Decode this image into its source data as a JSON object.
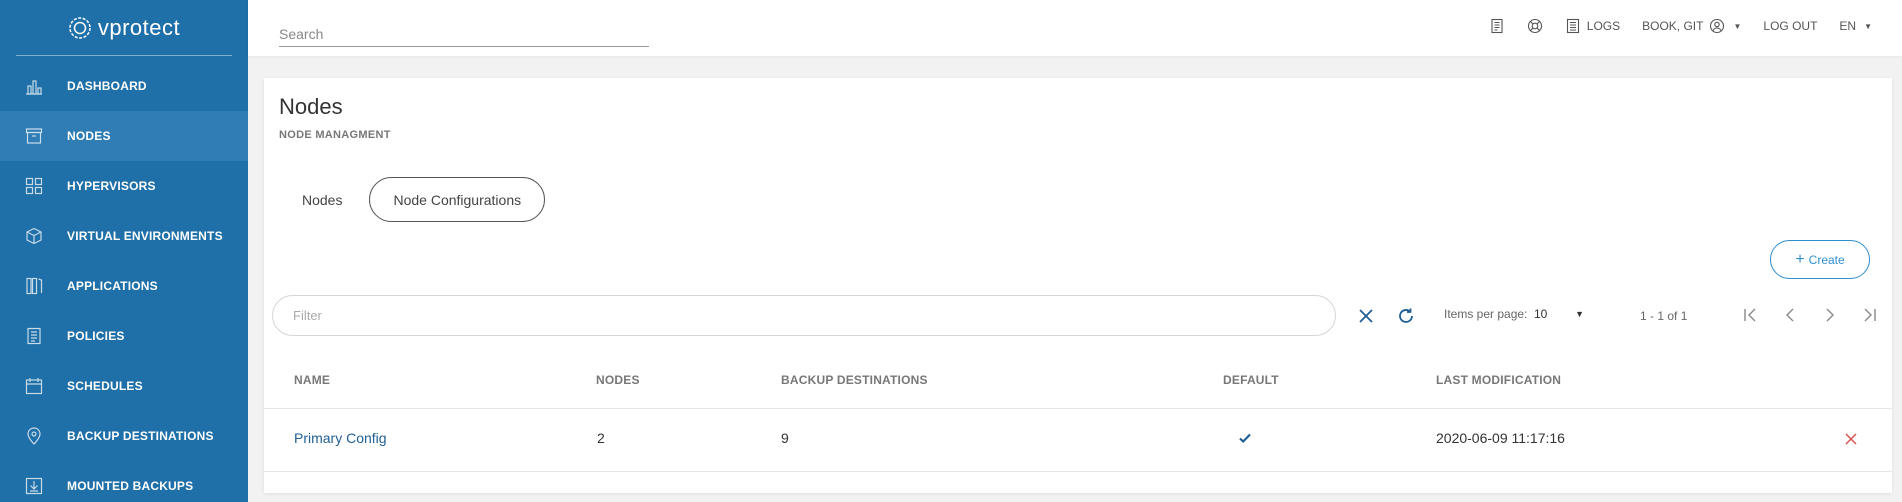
{
  "brand": {
    "name": "vprotect"
  },
  "sidebar": {
    "items": [
      {
        "label": "DASHBOARD",
        "icon": "chart-icon",
        "active": false
      },
      {
        "label": "NODES",
        "icon": "archive-box-icon",
        "active": true
      },
      {
        "label": "HYPERVISORS",
        "icon": "grid-icon",
        "active": false
      },
      {
        "label": "VIRTUAL ENVIRONMENTS",
        "icon": "cube-icon",
        "active": false
      },
      {
        "label": "APPLICATIONS",
        "icon": "app-columns-icon",
        "active": false
      },
      {
        "label": "POLICIES",
        "icon": "document-icon",
        "active": false
      },
      {
        "label": "SCHEDULES",
        "icon": "calendar-icon",
        "active": false
      },
      {
        "label": "BACKUP DESTINATIONS",
        "icon": "location-pin-icon",
        "active": false
      },
      {
        "label": "MOUNTED BACKUPS",
        "icon": "download-box-icon",
        "active": false
      }
    ]
  },
  "topbar": {
    "search_placeholder": "Search",
    "logs_label": "LOGS",
    "user_label": "BOOK, GIT",
    "logout_label": "LOG OUT",
    "language": "EN"
  },
  "page": {
    "title": "Nodes",
    "subtitle": "NODE MANAGMENT",
    "tabs": [
      {
        "label": "Nodes",
        "active": false
      },
      {
        "label": "Node Configurations",
        "active": true
      }
    ],
    "create_label": "Create"
  },
  "toolbar": {
    "filter_placeholder": "Filter",
    "items_per_page_label": "Items per page:",
    "items_per_page_value": "10",
    "range_label": "1 - 1 of 1"
  },
  "table": {
    "columns": [
      "NAME",
      "NODES",
      "BACKUP DESTINATIONS",
      "DEFAULT",
      "LAST MODIFICATION"
    ],
    "rows": [
      {
        "name": "Primary Config",
        "nodes": "2",
        "backup_destinations": "9",
        "default": true,
        "last_modification": "2020-06-09 11:17:16"
      }
    ]
  },
  "colors": {
    "sidebar": "#1f6fa8",
    "sidebar_active": "#2f7db4",
    "accent": "#2f8fd0",
    "link": "#1f5f94",
    "delete": "#d9534f"
  }
}
